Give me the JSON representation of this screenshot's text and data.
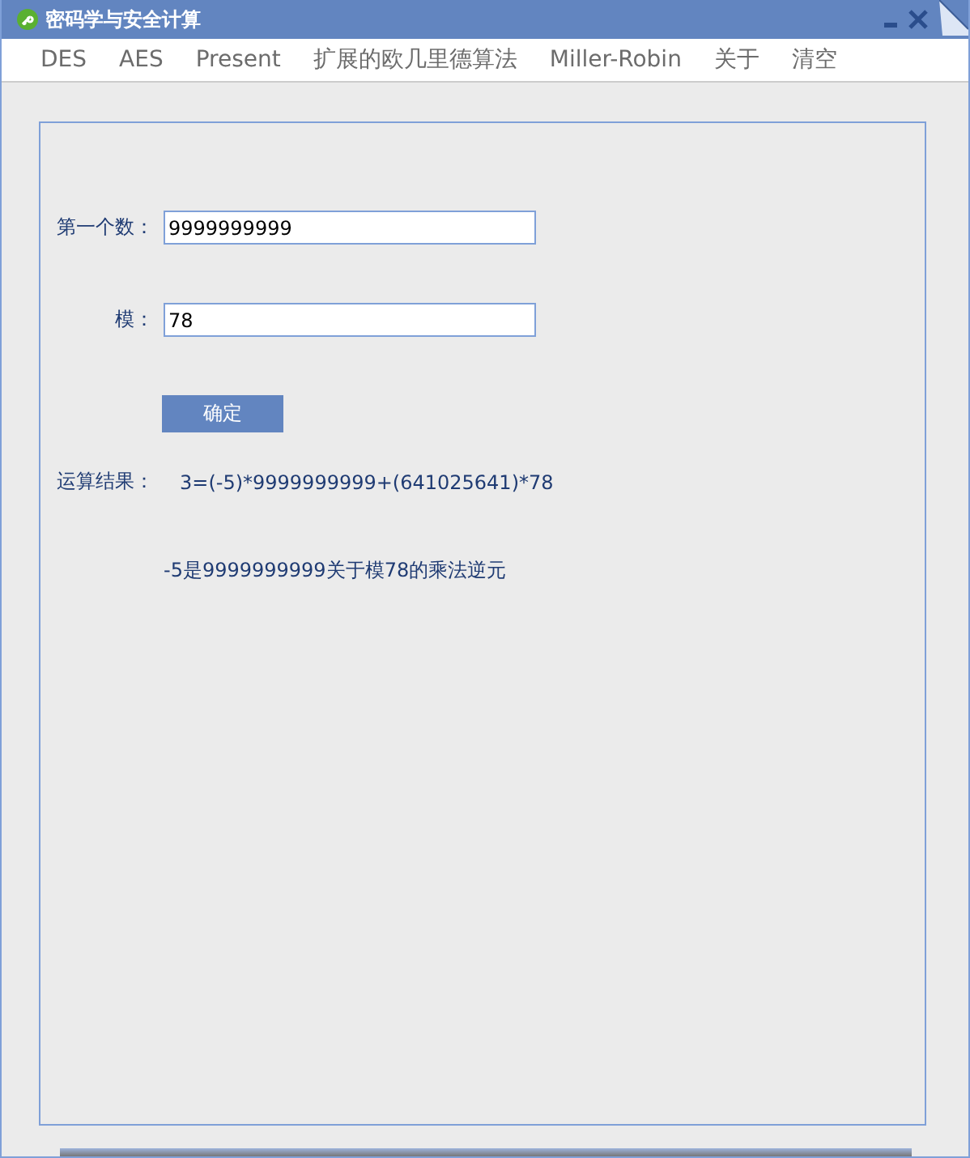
{
  "window": {
    "title": "密码学与安全计算"
  },
  "menu": [
    "DES",
    "AES",
    "Present",
    "扩展的欧几里德算法",
    "Miller-Robin",
    "关于",
    "清空"
  ],
  "fields": [
    {
      "label": "第一个数：",
      "value": "9999999999"
    },
    {
      "label": "模：",
      "value": "78"
    }
  ],
  "button": "确定",
  "result": {
    "label": "运算结果：",
    "text": "3=(-5)*9999999999+(641025641)*78"
  },
  "conclusion": "-5是9999999999关于模78的乘法逆元"
}
